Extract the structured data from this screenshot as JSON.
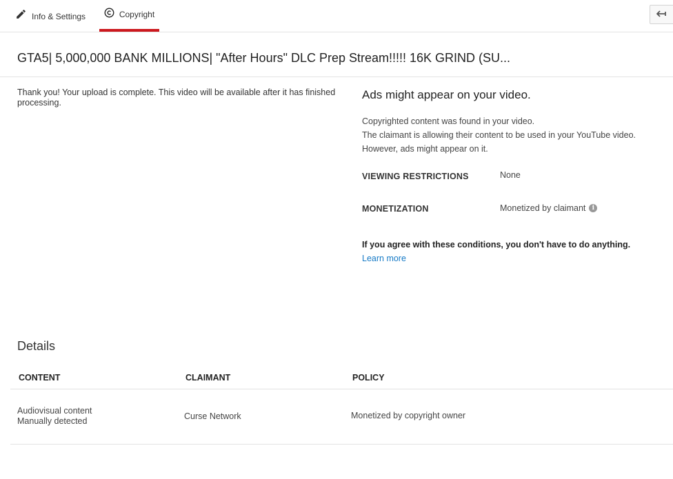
{
  "tabs": {
    "info_settings": {
      "label": "Info & Settings",
      "icon": "pencil-icon"
    },
    "copyright": {
      "label": "Copyright",
      "icon": "copyright-icon",
      "active": true
    }
  },
  "back_button": {
    "icon": "back-arrow-icon"
  },
  "video": {
    "title": "GTA5| 5,000,000 BANK MILLIONS| \"After Hours\" DLC Prep Stream!!!!! 16K GRIND (SU..."
  },
  "upload_message": "Thank you! Your upload is complete. This video will be available after it has finished processing.",
  "claim": {
    "heading": "Ads might appear on your video.",
    "lines": [
      "Copyrighted content was found in your video.",
      "The claimant is allowing their content to be used in your YouTube video.",
      "However, ads might appear on it."
    ],
    "viewing_restrictions": {
      "label": "VIEWING RESTRICTIONS",
      "value": "None"
    },
    "monetization": {
      "label": "MONETIZATION",
      "value": "Monetized by claimant"
    },
    "agree_text": "If you agree with these conditions, you don't have to do anything.",
    "learn_more": "Learn more"
  },
  "details": {
    "title": "Details",
    "columns": [
      "CONTENT",
      "CLAIMANT",
      "POLICY"
    ],
    "rows": [
      {
        "content_line1": "Audiovisual content",
        "content_line2": "Manually detected",
        "claimant": "Curse Network",
        "policy": "Monetized by copyright owner"
      }
    ]
  },
  "colors": {
    "active_tab_underline": "#cc181e",
    "link": "#167ac6",
    "divider": "#e2e2e2"
  }
}
